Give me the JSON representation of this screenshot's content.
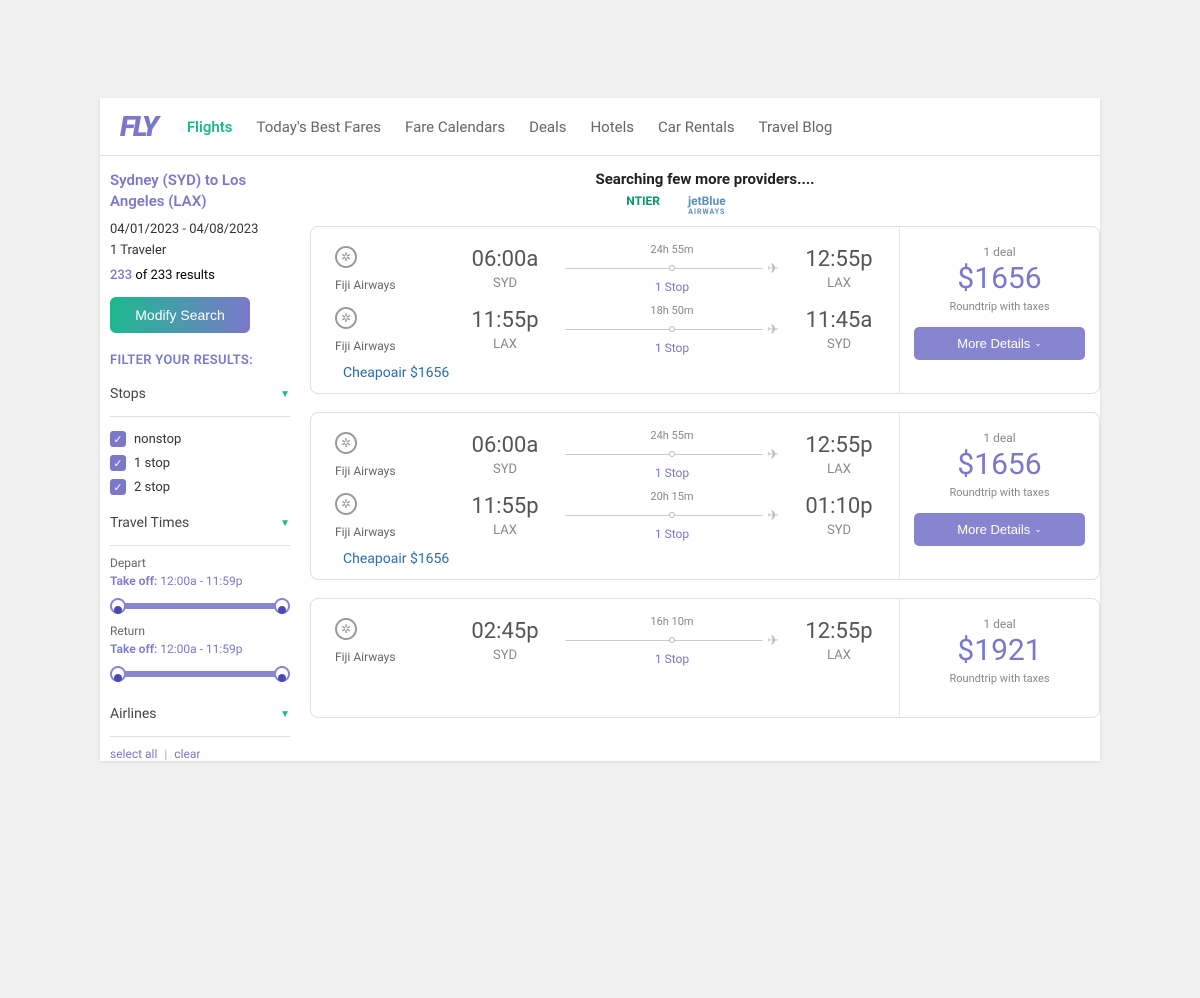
{
  "nav": {
    "items": [
      "Flights",
      "Today's Best Fares",
      "Fare Calendars",
      "Deals",
      "Hotels",
      "Car Rentals",
      "Travel Blog"
    ]
  },
  "sidebar": {
    "route": "Sydney (SYD) to Los Angeles (LAX)",
    "dates": "04/01/2023 - 04/08/2023",
    "travelers": "1 Traveler",
    "results_count": "233",
    "results_suffix": " of 233 results",
    "modify_label": "Modify Search",
    "filter_header": "FILTER YOUR RESULTS:",
    "stops_title": "Stops",
    "stops_options": [
      "nonstop",
      "1 stop",
      "2 stop"
    ],
    "travel_times_title": "Travel Times",
    "depart_label": "Depart",
    "return_label": "Return",
    "takeoff_label": "Take off:",
    "takeoff_range": "12:00a - 11:59p",
    "airlines_title": "Airlines",
    "select_all": "select all",
    "clear": "clear"
  },
  "searching": {
    "text": "Searching few more providers....",
    "provider1": "NTIER",
    "provider2": "jetBlue",
    "provider2_sub": "AIRWAYS"
  },
  "results": [
    {
      "airline": "Fiji Airways",
      "out_time_dep": "06:00a",
      "out_code_dep": "SYD",
      "out_duration": "24h 55m",
      "out_stops": "1 Stop",
      "out_time_arr": "12:55p",
      "out_code_arr": "LAX",
      "ret_time_dep": "11:55p",
      "ret_code_dep": "LAX",
      "ret_duration": "18h 50m",
      "ret_stops": "1 Stop",
      "ret_time_arr": "11:45a",
      "ret_code_arr": "SYD",
      "cheapo": "Cheapoair $1656",
      "deal_count": "1 deal",
      "price": "$1656",
      "price_note": "Roundtrip with taxes",
      "details_label": "More Details"
    },
    {
      "airline": "Fiji Airways",
      "out_time_dep": "06:00a",
      "out_code_dep": "SYD",
      "out_duration": "24h 55m",
      "out_stops": "1 Stop",
      "out_time_arr": "12:55p",
      "out_code_arr": "LAX",
      "ret_time_dep": "11:55p",
      "ret_code_dep": "LAX",
      "ret_duration": "20h 15m",
      "ret_stops": "1 Stop",
      "ret_time_arr": "01:10p",
      "ret_code_arr": "SYD",
      "cheapo": "Cheapoair $1656",
      "deal_count": "1 deal",
      "price": "$1656",
      "price_note": "Roundtrip with taxes",
      "details_label": "More Details"
    },
    {
      "airline": "Fiji Airways",
      "out_time_dep": "02:45p",
      "out_code_dep": "SYD",
      "out_duration": "16h 10m",
      "out_stops": "1 Stop",
      "out_time_arr": "12:55p",
      "out_code_arr": "LAX",
      "deal_count": "1 deal",
      "price": "$1921",
      "price_note": "Roundtrip with taxes"
    }
  ]
}
